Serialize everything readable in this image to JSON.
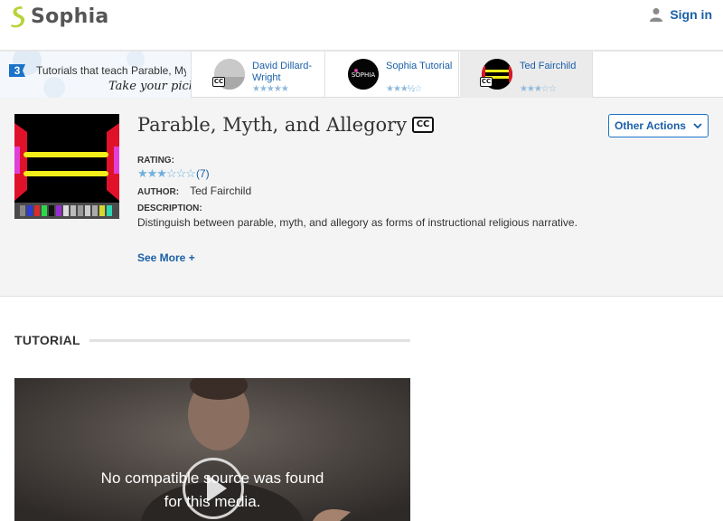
{
  "header": {
    "logo_text": "Sophia",
    "signin_label": "Sign in"
  },
  "picks": {
    "count": "3",
    "intro": "Tutorials that teach Parable, My",
    "tagline": "Take your pick:",
    "cards": [
      {
        "name": "David Dillard-Wright",
        "stars": "★★★★★",
        "cc": "CC"
      },
      {
        "name": "Sophia Tutorial",
        "stars": "★★★½☆",
        "cc": ""
      },
      {
        "name": "Ted Fairchild",
        "stars": "★★★☆☆",
        "cc": "CC"
      }
    ]
  },
  "tutorial": {
    "title": "Parable, Myth, and Allegory",
    "cc_badge": "CC",
    "rating_label": "RATING:",
    "stars": "★★★☆☆☆",
    "rating_count": "(7)",
    "author_label": "AUTHOR:",
    "author": "Ted Fairchild",
    "description_label": "DESCRIPTION:",
    "description": "Distinguish between parable, myth, and allegory as forms of instructional religious narrative.",
    "see_more": "See More +",
    "other_actions": "Other Actions"
  },
  "section": {
    "title": "TUTORIAL"
  },
  "video": {
    "message_line1": "No compatible source was found",
    "message_line2": "for this media."
  },
  "colors": {
    "link": "#1a5fa8",
    "star": "#6fb0dd",
    "logo_green": "#b6d43a"
  }
}
